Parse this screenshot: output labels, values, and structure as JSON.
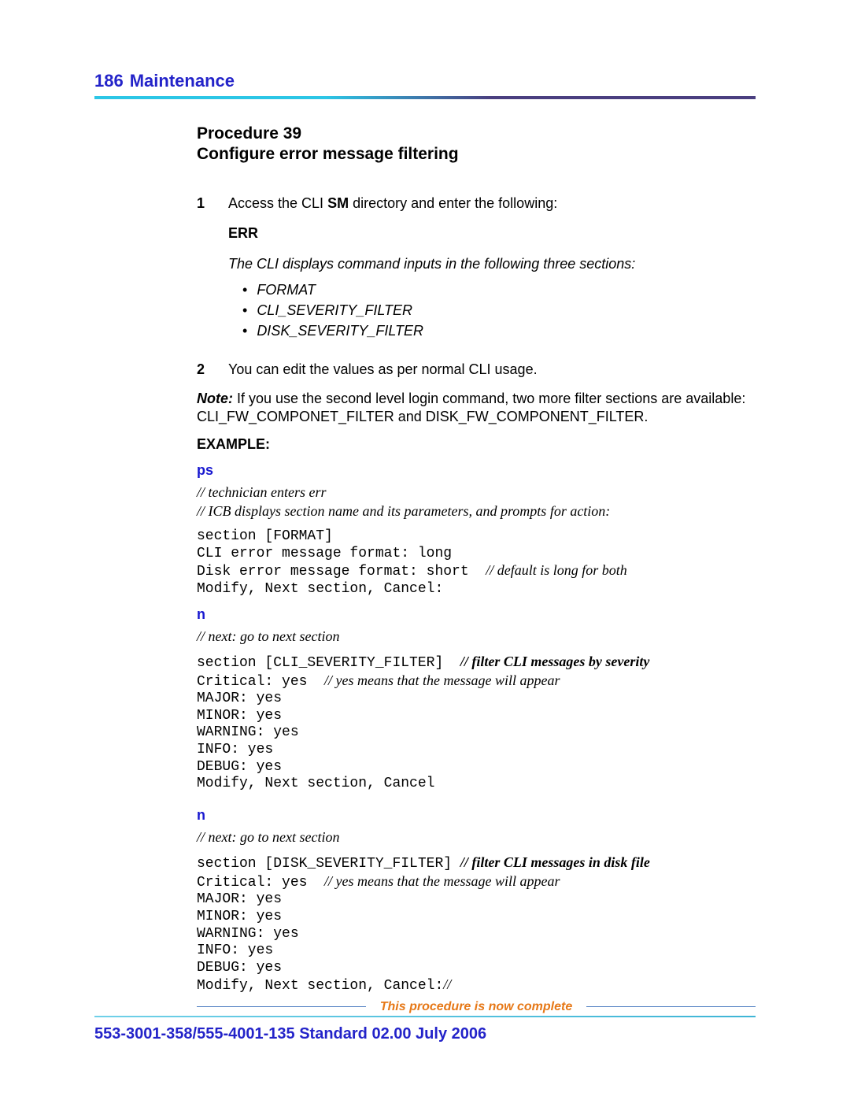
{
  "header": {
    "page_no": "186",
    "section": "Maintenance"
  },
  "procedure": {
    "label": "Procedure 39",
    "title": "Configure error message filtering"
  },
  "steps": {
    "s1_num": "1",
    "s1_prefix": "Access the CLI ",
    "s1_bold": "SM",
    "s1_suffix": " directory and enter the following:",
    "err": "ERR",
    "cli_intro": "The CLI displays command inputs in the following three sections:",
    "bullets": {
      "b1": "FORMAT",
      "b2": "CLI_SEVERITY_FILTER",
      "b3": "DISK_SEVERITY_FILTER"
    },
    "s2_num": "2",
    "s2_text": "You can edit the values as per normal CLI usage.",
    "note_label": "Note:",
    "note_text": "  If you use the second level login command, two more filter sections are available: CLI_FW_COMPONET_FILTER and DISK_FW_COMPONENT_FILTER.",
    "example_label": "EXAMPLE:",
    "cmd_ps": "ps",
    "c1": "// technician enters err",
    "c2": "// ICB displays section name and its parameters, and prompts for action:",
    "block1_l1": "section [FORMAT]",
    "block1_l2": "CLI error message format: long",
    "block1_l3a": "Disk error message format: short  ",
    "block1_l3b": "// default is long for both",
    "block1_l4": "Modify, Next section, Cancel:",
    "cmd_n1": "n",
    "c3": "// next: go to next section",
    "block2_l1a": "section [CLI_SEVERITY_FILTER]  ",
    "block2_l1b": "// filter CLI messages by severity",
    "block2_l2a": "Critical: yes  ",
    "block2_l2b": "// yes means that the message will appear",
    "block2_l3": "MAJOR: yes",
    "block2_l4": "MINOR: yes",
    "block2_l5": "WARNING: yes",
    "block2_l6": "INFO: yes",
    "block2_l7": "DEBUG: yes",
    "block2_l8": "Modify, Next section, Cancel",
    "cmd_n2": "n",
    "c4": "// next: go to next section",
    "block3_l1a": "section [DISK_SEVERITY_FILTER] ",
    "block3_l1b": "// filter CLI messages in disk file",
    "block3_l2a": "Critical: yes  ",
    "block3_l2b": "// yes means that the message will appear",
    "block3_l3": "MAJOR: yes",
    "block3_l4": "MINOR: yes",
    "block3_l5": "WARNING: yes",
    "block3_l6": "INFO: yes",
    "block3_l7": "DEBUG: yes",
    "block3_l8a": "Modify, Next section, Cancel:",
    "block3_l8b": "//"
  },
  "complete": "This procedure is now complete",
  "footer": "553-3001-358/555-4001-135   Standard   02.00   July 2006"
}
